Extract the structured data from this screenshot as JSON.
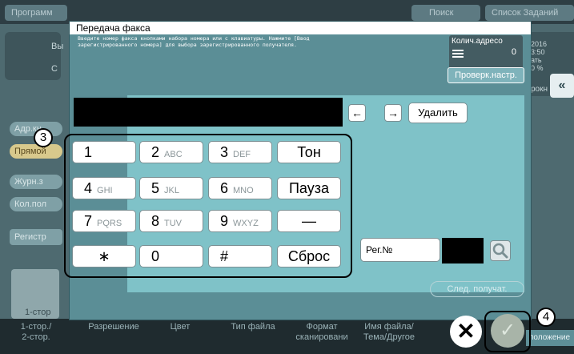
{
  "background": {
    "tabs": [
      "Программ",
      "Поиск",
      "Список Заданий"
    ],
    "left_label": "Вы",
    "left_label2": "С",
    "pills": [
      "Адр.кн",
      "Прямой",
      "Журн.з",
      "Кол.пол"
    ],
    "register": "Регистр",
    "page_label": "1-стор",
    "bottom_items": [
      "1-стор./\n2-стор.",
      "Разрешение",
      "Цвет",
      "Тип файла",
      "Формат\nсканировани",
      "Имя файла/\nТема/Другое"
    ],
    "right_info": [
      "2016",
      "3:50",
      "ать",
      "0 %"
    ],
    "right_panel_label": "рокн",
    "layout_label": "положение"
  },
  "dialog": {
    "title": "Передача факса",
    "instructions": "Введите номер факса кнопками набора номера или с клавиатуры. Нажмите [Ввод зарегистрированного номера] для выбора зарегистрированного получателя.",
    "dest_count_label": "Колич.адресо",
    "dest_count_value": "0",
    "check_settings": "Проверк.настр.",
    "number_value": "",
    "left_arrow": "←",
    "right_arrow": "→",
    "delete": "Удалить",
    "keys": [
      {
        "main": "1",
        "sub": ""
      },
      {
        "main": "2",
        "sub": "ABC"
      },
      {
        "main": "3",
        "sub": "DEF"
      },
      {
        "main": "Тон",
        "sub": ""
      },
      {
        "main": "4",
        "sub": "GHI"
      },
      {
        "main": "5",
        "sub": "JKL"
      },
      {
        "main": "6",
        "sub": "MNO"
      },
      {
        "main": "Пауза",
        "sub": ""
      },
      {
        "main": "7",
        "sub": "PQRS"
      },
      {
        "main": "8",
        "sub": "TUV"
      },
      {
        "main": "9",
        "sub": "WXYZ"
      },
      {
        "main": "—",
        "sub": ""
      },
      {
        "main": "∗",
        "sub": ""
      },
      {
        "main": "0",
        "sub": ""
      },
      {
        "main": "#",
        "sub": ""
      },
      {
        "main": "Сброс",
        "sub": ""
      }
    ],
    "reg_no": "Рег.№",
    "next_recipient": "След. получат.",
    "cancel": "✕",
    "ok": "✓"
  },
  "callouts": [
    "3",
    "4"
  ],
  "icons": [
    "list-icon",
    "search-icon",
    "cancel-icon",
    "ok-check-icon",
    "arrow-left-icon",
    "arrow-right-icon",
    "collapse-icon"
  ]
}
